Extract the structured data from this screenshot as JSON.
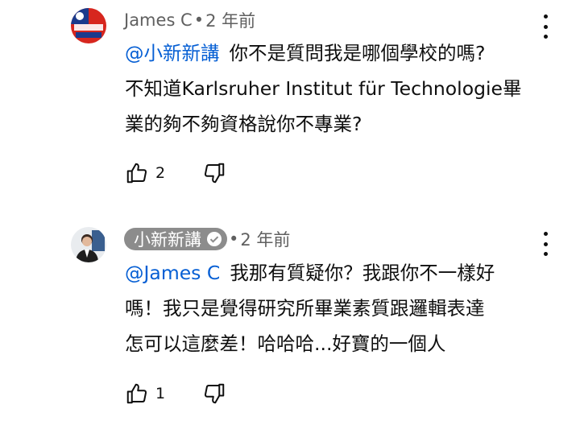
{
  "comments": [
    {
      "author": "James C",
      "time": "2 年前",
      "separator": "•",
      "mention": "@小新新講",
      "lines": [
        "你不是質問我是哪個學校的嗎?",
        "不知道Karlsruher Institut für Technologie畢",
        "業的夠不夠資格說你不專業?"
      ],
      "likes": "2",
      "avatar_text": "中華民國 加油! 加油!"
    },
    {
      "author": "小新新講",
      "time": "2 年前",
      "separator": "•",
      "mention": "@James C",
      "lines": [
        "我那有質疑你？我跟你不一樣好",
        "嗎！我只是覺得研究所畢業素質跟邏輯表達",
        "怎可以這麼差！哈哈哈...好寶的一個人"
      ],
      "likes": "1"
    }
  ],
  "icons": {
    "like": "thumb-up-icon",
    "dislike": "thumb-down-icon",
    "menu": "more-vert-icon",
    "verified": "check-circle-icon"
  },
  "colors": {
    "mention": "#065fd4",
    "meta": "#606060",
    "owner_chip": "#8c8c8c"
  }
}
